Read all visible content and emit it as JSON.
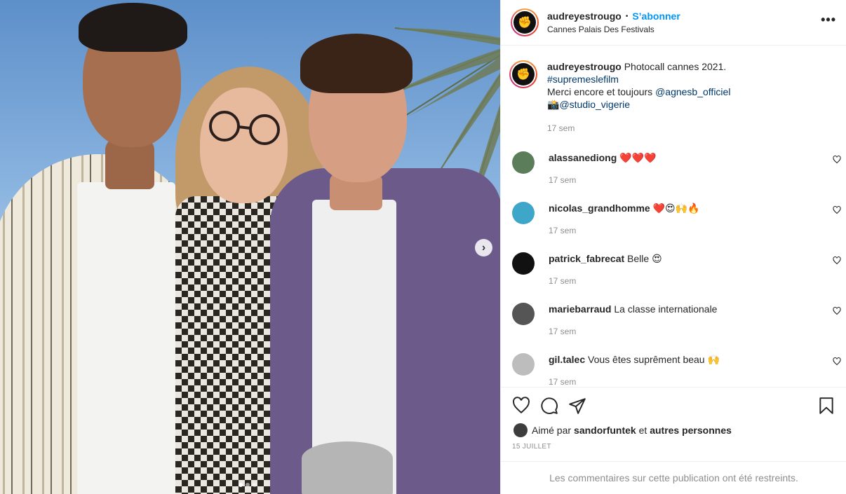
{
  "post": {
    "username": "audreyestrougo",
    "separator": "•",
    "follow_label": "S’abonner",
    "location": "Cannes Palais Des Festivals",
    "more_label": "•••"
  },
  "caption": {
    "username": "audreyestrougo",
    "line1": "Photocall cannes 2021.",
    "hashtag": "#supremeslefilm",
    "line3_prefix": "Merci encore et toujours ",
    "mention1": "@agnesb_officiel",
    "camera_emoji": "📸",
    "mention2": "@studio_vigerie",
    "time": "17 sem"
  },
  "comments": [
    {
      "username": "alassanediong",
      "text": "❤️❤️❤️",
      "time": "17 sem",
      "avatar_color": "#5c7d5a"
    },
    {
      "username": "nicolas_grandhomme",
      "text": "❤️😍🙌🔥",
      "time": "17 sem",
      "avatar_color": "#3ea6c9"
    },
    {
      "username": "patrick_fabrecat",
      "text": "Belle 😍",
      "time": "17 sem",
      "avatar_color": "#111111"
    },
    {
      "username": "mariebarraud",
      "text": "La classe internationale",
      "time": "17 sem",
      "avatar_color": "#555555"
    },
    {
      "username": "gil.talec",
      "text": "Vous êtes suprêment beau 🙌",
      "time": "17 sem",
      "avatar_color": "#bdbdbd"
    }
  ],
  "likes": {
    "prefix": "Aimé par ",
    "user": "sandorfuntek",
    "middle": " et ",
    "others": "autres personnes"
  },
  "date": "15 JUILLET",
  "restricted_text": "Les commentaires sur cette publication ont été restreints.",
  "carousel": {
    "current": 1,
    "total": 3
  },
  "icons": {
    "like": "heart-icon",
    "comment": "comment-icon",
    "share": "paper-plane-icon",
    "save": "bookmark-icon",
    "next": "chevron-right-icon"
  },
  "colors": {
    "accent": "#0095f6",
    "link": "#00376b",
    "muted": "#8e8e8e"
  }
}
